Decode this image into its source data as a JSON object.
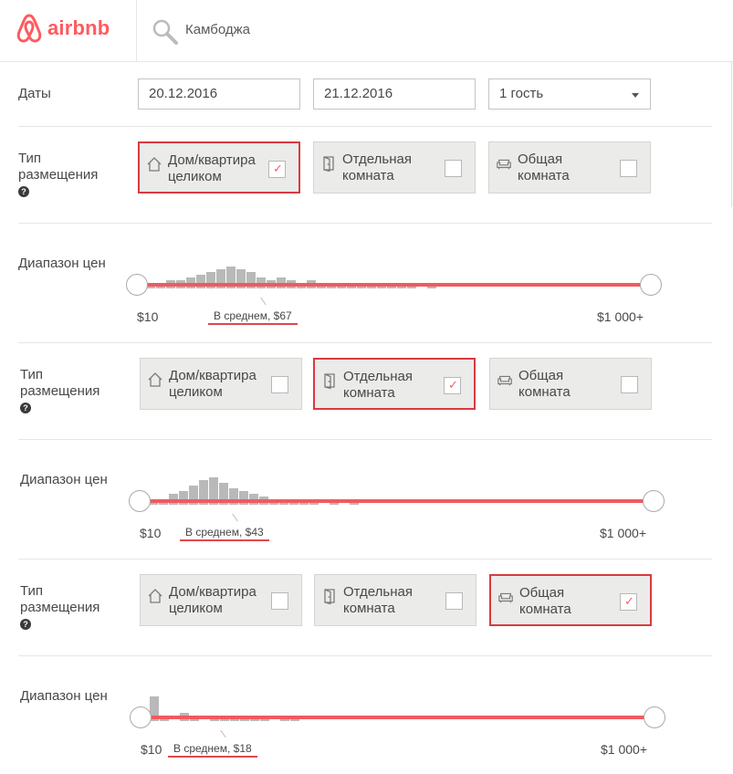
{
  "header": {
    "brand": "airbnb",
    "search": "Камбоджа"
  },
  "dates": {
    "label": "Даты",
    "checkin": "20.12.2016",
    "checkout": "21.12.2016",
    "guests": "1 гость"
  },
  "room_type_label_1": "Тип",
  "room_type_label_2": "размещения",
  "help_symbol": "?",
  "price_label": "Диапазон цен",
  "price_min": "$10",
  "price_max": "$1 000+",
  "sections": [
    {
      "options": [
        {
          "l1": "Дом/квартира",
          "l2": "целиком",
          "checked": true
        },
        {
          "l1": "Отдельная",
          "l2": "комната",
          "checked": false
        },
        {
          "l1": "Общая",
          "l2": "комната",
          "checked": false
        }
      ],
      "average": "В среднем, $67",
      "histogram": [
        1,
        2,
        3,
        3,
        4,
        5,
        6,
        7,
        8,
        7,
        6,
        4,
        3,
        4,
        3,
        2,
        3,
        1,
        1,
        1,
        2,
        1,
        2,
        1,
        1,
        1,
        1,
        0,
        1
      ]
    },
    {
      "options": [
        {
          "l1": "Дом/квартира",
          "l2": "целиком",
          "checked": false
        },
        {
          "l1": "Отдельная",
          "l2": "комната",
          "checked": true
        },
        {
          "l1": "Общая",
          "l2": "комната",
          "checked": false
        }
      ],
      "average": "В среднем, $43",
      "histogram": [
        1,
        2,
        4,
        5,
        7,
        9,
        10,
        8,
        6,
        5,
        4,
        3,
        2,
        2,
        1,
        1,
        1,
        0,
        1,
        0,
        1,
        0,
        0,
        0,
        0,
        0,
        0,
        0,
        0
      ]
    },
    {
      "options": [
        {
          "l1": "Дом/квартира",
          "l2": "целиком",
          "checked": false
        },
        {
          "l1": "Отдельная",
          "l2": "комната",
          "checked": false
        },
        {
          "l1": "Общая",
          "l2": "комната",
          "checked": true
        }
      ],
      "average": "В среднем, $18",
      "histogram": [
        9,
        1,
        0,
        3,
        1,
        0,
        1,
        2,
        1,
        1,
        1,
        1,
        0,
        1,
        1,
        0,
        0,
        0,
        0,
        0,
        0,
        0,
        0,
        0,
        0,
        0,
        0,
        0,
        0
      ]
    }
  ]
}
